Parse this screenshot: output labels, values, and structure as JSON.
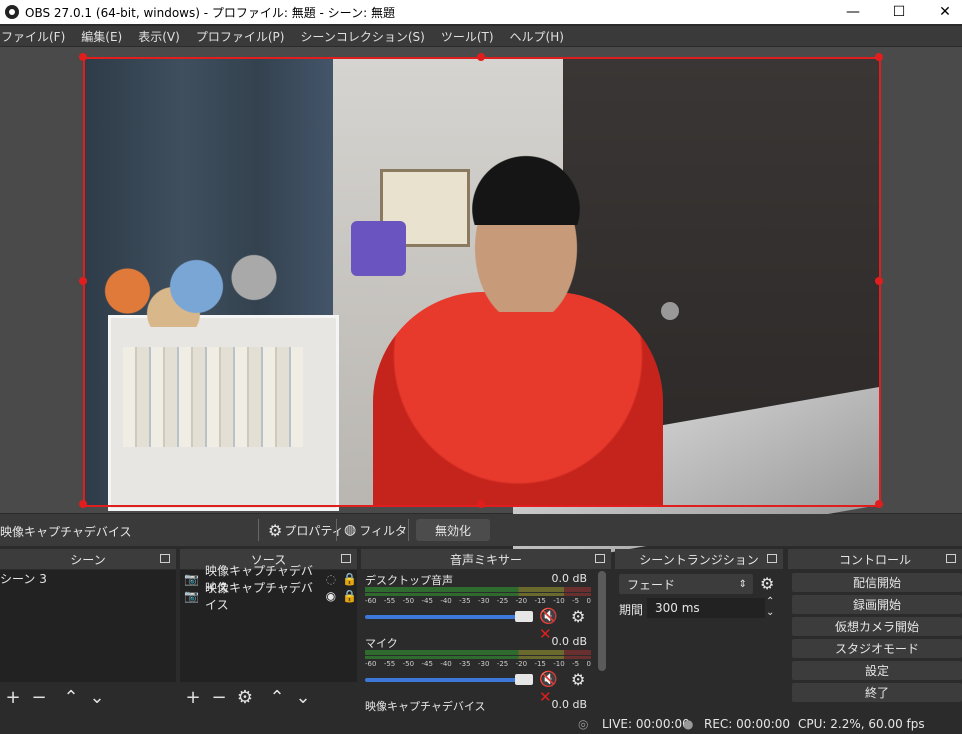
{
  "window": {
    "title": "OBS 27.0.1 (64-bit, windows) - プロファイル: 無題 - シーン: 無題",
    "minimize": "—",
    "maximize": "☐",
    "close": "✕"
  },
  "menu": [
    "ファイル(F)",
    "編集(E)",
    "表示(V)",
    "プロファイル(P)",
    "シーンコレクション(S)",
    "ツール(T)",
    "ヘルプ(H)"
  ],
  "source_toolbar": {
    "source_name": "映像キャプチャデバイス",
    "properties": "プロパティ",
    "filters": "フィルタ",
    "deactivate": "無効化"
  },
  "scenes": {
    "title": "シーン",
    "items": [
      "シーン 3"
    ]
  },
  "sources": {
    "title": "ソース",
    "items": [
      "映像キャプチャデバイス",
      "映像キャプチャデバイス"
    ]
  },
  "mixer": {
    "title": "音声ミキサー",
    "ticks": [
      "-60",
      "-55",
      "-50",
      "-45",
      "-40",
      "-35",
      "-30",
      "-25",
      "-20",
      "-15",
      "-10",
      "-5",
      "0"
    ],
    "channels": [
      {
        "name": "デスクトップ音声",
        "db": "0.0 dB",
        "muted": true
      },
      {
        "name": "マイク",
        "db": "0.0 dB",
        "muted": true
      },
      {
        "name": "映像キャプチャデバイス",
        "db": "0.0 dB"
      }
    ]
  },
  "transitions": {
    "title": "シーントランジション",
    "type": "フェード",
    "duration_label": "期間",
    "duration": "300 ms"
  },
  "controls": {
    "title": "コントロール",
    "buttons": [
      "配信開始",
      "録画開始",
      "仮想カメラ開始",
      "スタジオモード",
      "設定",
      "終了"
    ]
  },
  "status": {
    "live": "LIVE: 00:00:00",
    "rec": "REC: 00:00:00",
    "cpu": "CPU: 2.2%, 60.00 fps"
  },
  "colors": {
    "selection": "#e01e1e",
    "volume": "#3c78d8",
    "mute": "#e01e1e"
  }
}
